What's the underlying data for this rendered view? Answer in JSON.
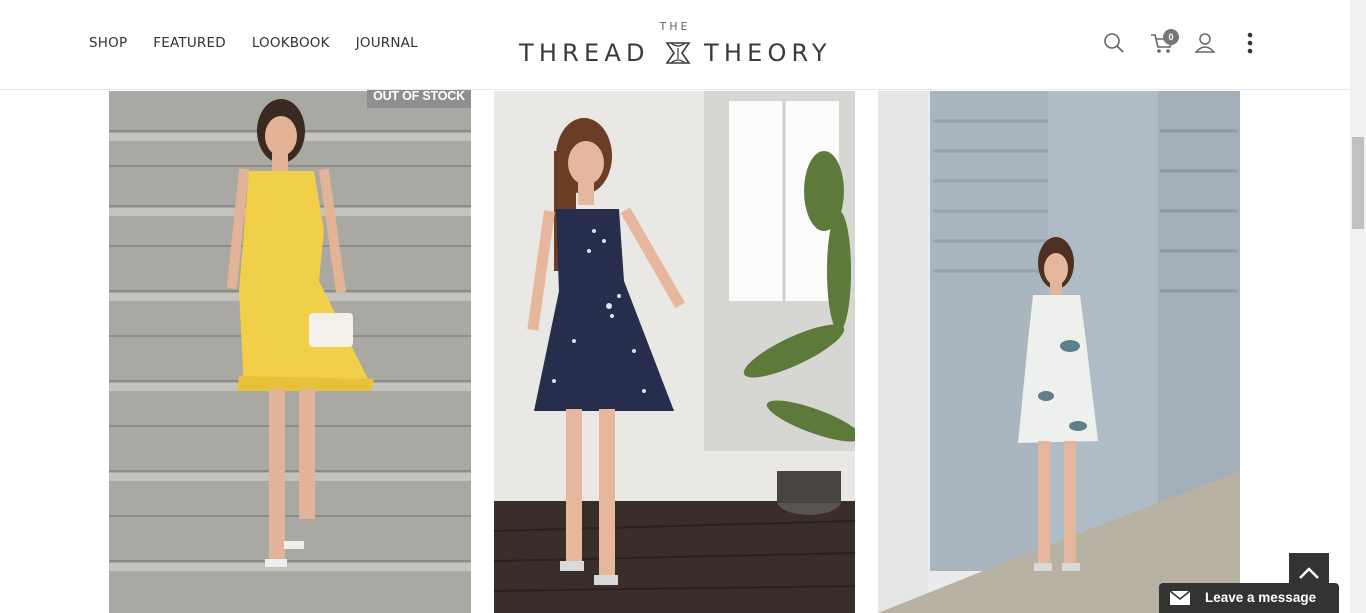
{
  "nav": {
    "items": [
      "SHOP",
      "FEATURED",
      "LOOKBOOK",
      "JOURNAL"
    ]
  },
  "logo": {
    "top": "THE",
    "left": "THREAD",
    "right": "THEORY"
  },
  "header_icons": [
    "search-icon",
    "cart-icon",
    "user-icon",
    "more-vertical-icon"
  ],
  "cart": {
    "count": "0"
  },
  "products": [
    {
      "badge": "OUT OF STOCK",
      "dress_color": "#f2cf48"
    },
    {
      "dress_color": "#262d4d"
    },
    {
      "dress_color": "#eef0ee"
    }
  ],
  "chat": {
    "label": "Leave a message"
  },
  "colors": {
    "header_bg": "#ffffff",
    "chat_bg": "#333333",
    "badge_bg": "#8f8f8f"
  }
}
